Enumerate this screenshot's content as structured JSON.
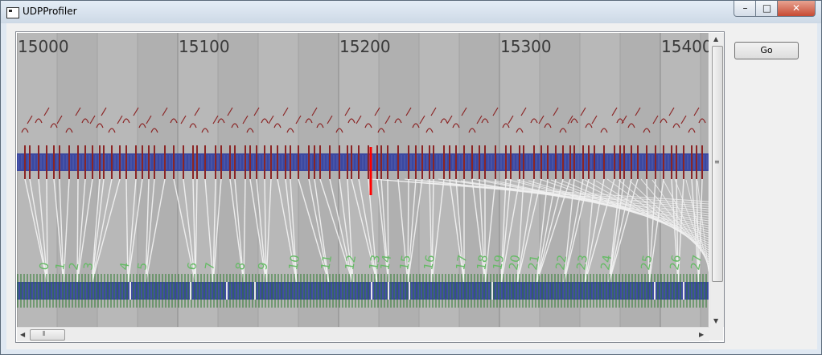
{
  "window": {
    "title": "UDPProfiler"
  },
  "controls": {
    "minimize": "–",
    "maximize": "□",
    "close": "✕"
  },
  "toolbar": {
    "go_label": "Go"
  },
  "ruler": {
    "labels": [
      "15000",
      "15100",
      "15200",
      "15300",
      "15400"
    ]
  },
  "packets": {
    "labels": [
      "0",
      "1",
      "2",
      "3",
      "4",
      "5",
      "6",
      "7",
      "8",
      "9",
      "10",
      "11",
      "12",
      "13",
      "14",
      "15",
      "16",
      "17",
      "18",
      "19",
      "20",
      "21",
      "22",
      "23",
      "24",
      "25",
      "26",
      "27"
    ]
  },
  "colors": {
    "lane": "#3b48a0",
    "tick_red": "#8b2525",
    "tick_green": "#2d7a2d",
    "label_green": "#66bb66",
    "marker": "#ff0000",
    "canvas_bg": "#b4b4b4"
  },
  "icons": {
    "app": "window-icon",
    "scroll_up": "triangle-up-icon",
    "scroll_down": "triangle-down-icon",
    "scroll_left": "triangle-left-icon",
    "scroll_right": "triangle-right-icon"
  }
}
